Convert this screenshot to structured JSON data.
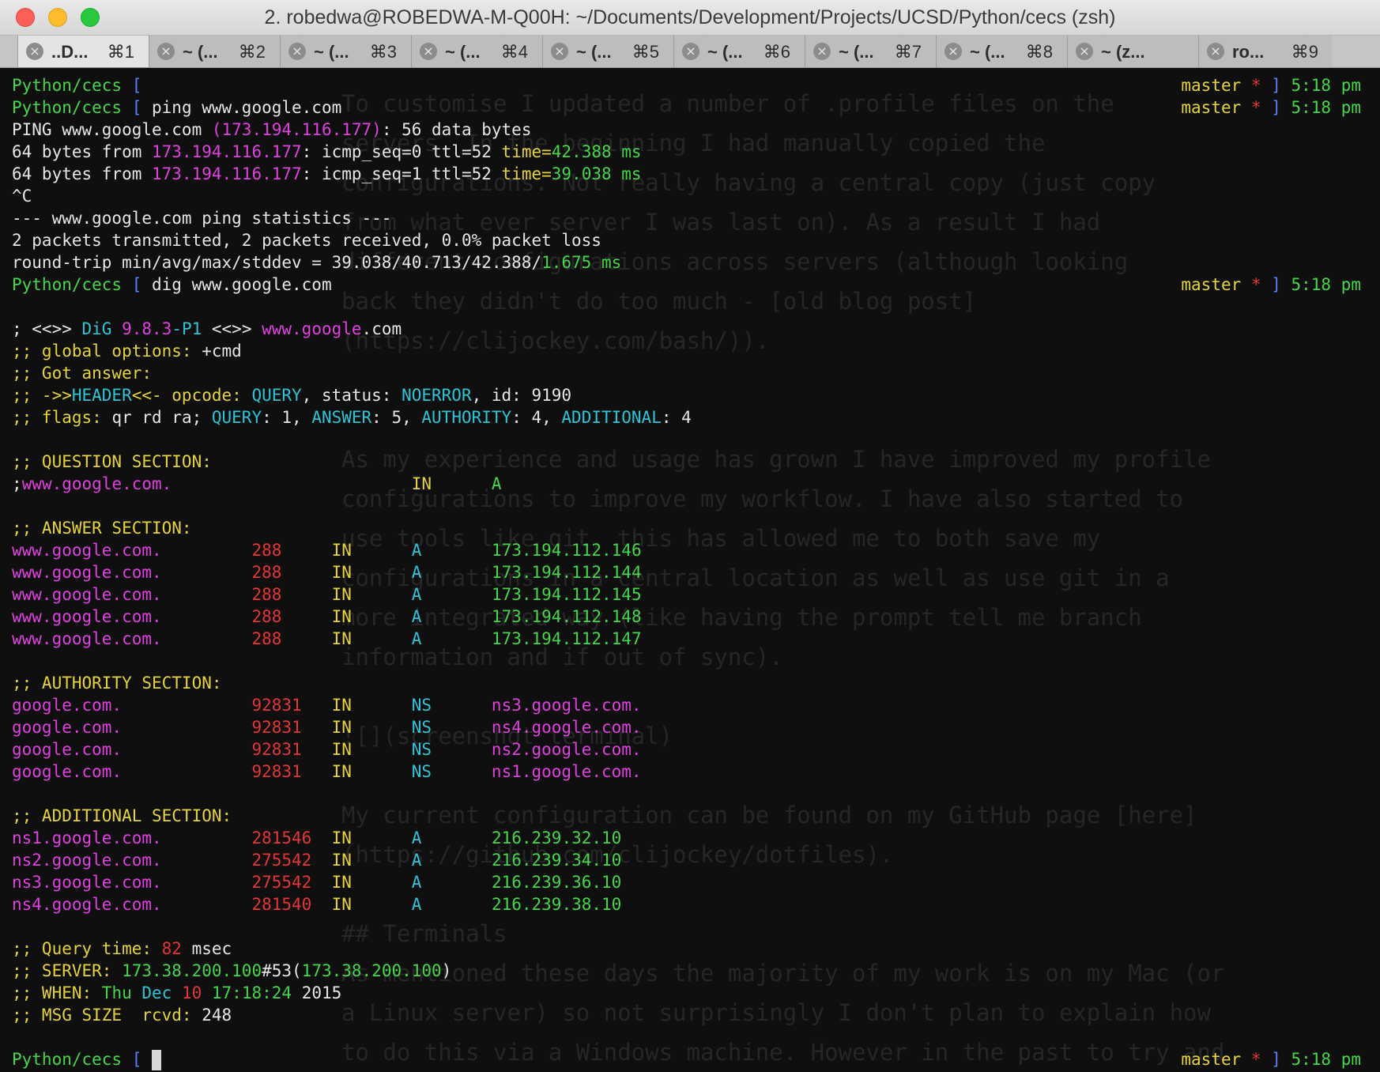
{
  "window": {
    "title": "2. robedwa@ROBEDWA-M-Q00H: ~/Documents/Development/Projects/UCSD/Python/cecs (zsh)"
  },
  "tabs": [
    {
      "label": "..D...",
      "shortcut": "⌘1",
      "active": true
    },
    {
      "label": "~ (...",
      "shortcut": "⌘2"
    },
    {
      "label": "~ (...",
      "shortcut": "⌘3"
    },
    {
      "label": "~ (...",
      "shortcut": "⌘4"
    },
    {
      "label": "~ (...",
      "shortcut": "⌘5"
    },
    {
      "label": "~ (...",
      "shortcut": "⌘6"
    },
    {
      "label": "~ (...",
      "shortcut": "⌘7"
    },
    {
      "label": "~ (...",
      "shortcut": "⌘8"
    },
    {
      "label": "~ (z...",
      "shortcut": ""
    },
    {
      "label": "ro...",
      "shortcut": "⌘9"
    }
  ],
  "terminal": {
    "lines": [
      {
        "segs": [
          [
            "Python/cecs",
            "green"
          ],
          [
            " [",
            "blue"
          ]
        ],
        "right": [
          [
            "master",
            "yellow"
          ],
          [
            " * ",
            "red"
          ],
          [
            "] ",
            "blue"
          ],
          [
            "5:18 pm",
            "green"
          ]
        ]
      },
      {
        "segs": [
          [
            "Python/cecs",
            "green"
          ],
          [
            " [ ",
            "blue"
          ],
          [
            "ping www.google.com",
            "white"
          ]
        ],
        "right": [
          [
            "master",
            "yellow"
          ],
          [
            " * ",
            "red"
          ],
          [
            "] ",
            "blue"
          ],
          [
            "5:18 pm",
            "green"
          ]
        ]
      },
      {
        "segs": [
          [
            "PING www.google.com ",
            "white"
          ],
          [
            "(173.194.116.177)",
            "magenta"
          ],
          [
            ": 56 data bytes",
            "white"
          ]
        ]
      },
      {
        "segs": [
          [
            "64 bytes from ",
            "white"
          ],
          [
            "173.194.116.177",
            "magenta"
          ],
          [
            ": icmp_seq=0 ttl=52 ",
            "white"
          ],
          [
            "time=",
            "yellow"
          ],
          [
            "42.388 ms",
            "green"
          ]
        ]
      },
      {
        "segs": [
          [
            "64 bytes from ",
            "white"
          ],
          [
            "173.194.116.177",
            "magenta"
          ],
          [
            ": icmp_seq=1 ttl=52 ",
            "white"
          ],
          [
            "time=",
            "yellow"
          ],
          [
            "39.038 ms",
            "green"
          ]
        ]
      },
      {
        "segs": [
          [
            "^C",
            "white"
          ]
        ]
      },
      {
        "segs": [
          [
            "--- www.google.com ping statistics ---",
            "white"
          ]
        ]
      },
      {
        "segs": [
          [
            "2 packets transmitted, 2 packets received, 0.0% packet loss",
            "white"
          ]
        ]
      },
      {
        "segs": [
          [
            "round-trip min/avg/max/stddev = 39.038/40.713/42.388/",
            "white"
          ],
          [
            "1.675 ms",
            "green"
          ]
        ]
      },
      {
        "segs": [
          [
            "Python/cecs",
            "green"
          ],
          [
            " [ ",
            "blue"
          ],
          [
            "dig www.google.com",
            "white"
          ]
        ],
        "right": [
          [
            "master",
            "yellow"
          ],
          [
            " * ",
            "red"
          ],
          [
            "] ",
            "blue"
          ],
          [
            "5:18 pm",
            "green"
          ]
        ]
      },
      {
        "segs": [
          [
            "",
            "white"
          ]
        ]
      },
      {
        "segs": [
          [
            "; <<>> ",
            "white"
          ],
          [
            "DiG",
            "cyan"
          ],
          [
            " 9.8.3",
            "magenta"
          ],
          [
            "-P1",
            "cyan"
          ],
          [
            " <<>> ",
            "white"
          ],
          [
            "www.google",
            "magenta"
          ],
          [
            ".com",
            "white"
          ]
        ]
      },
      {
        "segs": [
          [
            ";; global options: ",
            "yellow"
          ],
          [
            "+cmd",
            "white"
          ]
        ]
      },
      {
        "segs": [
          [
            ";; Got answer:",
            "yellow"
          ]
        ]
      },
      {
        "segs": [
          [
            ";; ->>",
            "yellow"
          ],
          [
            "HEADER",
            "cyan"
          ],
          [
            "<<- opcode: ",
            "yellow"
          ],
          [
            "QUERY",
            "cyan"
          ],
          [
            ", status: ",
            "white"
          ],
          [
            "NOERROR",
            "cyan"
          ],
          [
            ", id: 9190",
            "white"
          ]
        ]
      },
      {
        "segs": [
          [
            ";; flags: ",
            "yellow"
          ],
          [
            "qr rd ra; ",
            "white"
          ],
          [
            "QUERY",
            "cyan"
          ],
          [
            ": 1, ",
            "white"
          ],
          [
            "ANSWER",
            "cyan"
          ],
          [
            ": 5, ",
            "white"
          ],
          [
            "AUTHORITY",
            "cyan"
          ],
          [
            ": 4, ",
            "white"
          ],
          [
            "ADDITIONAL",
            "cyan"
          ],
          [
            ": 4",
            "white"
          ]
        ]
      },
      {
        "segs": [
          [
            "",
            "white"
          ]
        ]
      },
      {
        "segs": [
          [
            ";; QUESTION SECTION:",
            "yellow"
          ]
        ]
      },
      {
        "segs": [
          [
            ";",
            "white"
          ],
          [
            "www.google.com.",
            "magenta"
          ],
          [
            "                        ",
            "white"
          ],
          [
            "IN",
            "yellow"
          ],
          [
            "      ",
            "white"
          ],
          [
            "A",
            "green"
          ]
        ]
      },
      {
        "segs": [
          [
            "",
            "white"
          ]
        ]
      },
      {
        "segs": [
          [
            ";; ANSWER SECTION:",
            "yellow"
          ]
        ]
      },
      {
        "segs": [
          [
            "www.google.com.",
            "magenta"
          ],
          [
            "         ",
            "white"
          ],
          [
            "288",
            "red"
          ],
          [
            "     ",
            "white"
          ],
          [
            "IN",
            "yellow"
          ],
          [
            "      ",
            "white"
          ],
          [
            "A",
            "cyan"
          ],
          [
            "       ",
            "white"
          ],
          [
            "173.194.112.146",
            "green"
          ]
        ]
      },
      {
        "segs": [
          [
            "www.google.com.",
            "magenta"
          ],
          [
            "         ",
            "white"
          ],
          [
            "288",
            "red"
          ],
          [
            "     ",
            "white"
          ],
          [
            "IN",
            "yellow"
          ],
          [
            "      ",
            "white"
          ],
          [
            "A",
            "cyan"
          ],
          [
            "       ",
            "white"
          ],
          [
            "173.194.112.144",
            "green"
          ]
        ]
      },
      {
        "segs": [
          [
            "www.google.com.",
            "magenta"
          ],
          [
            "         ",
            "white"
          ],
          [
            "288",
            "red"
          ],
          [
            "     ",
            "white"
          ],
          [
            "IN",
            "yellow"
          ],
          [
            "      ",
            "white"
          ],
          [
            "A",
            "cyan"
          ],
          [
            "       ",
            "white"
          ],
          [
            "173.194.112.145",
            "green"
          ]
        ]
      },
      {
        "segs": [
          [
            "www.google.com.",
            "magenta"
          ],
          [
            "         ",
            "white"
          ],
          [
            "288",
            "red"
          ],
          [
            "     ",
            "white"
          ],
          [
            "IN",
            "yellow"
          ],
          [
            "      ",
            "white"
          ],
          [
            "A",
            "cyan"
          ],
          [
            "       ",
            "white"
          ],
          [
            "173.194.112.148",
            "green"
          ]
        ]
      },
      {
        "segs": [
          [
            "www.google.com.",
            "magenta"
          ],
          [
            "         ",
            "white"
          ],
          [
            "288",
            "red"
          ],
          [
            "     ",
            "white"
          ],
          [
            "IN",
            "yellow"
          ],
          [
            "      ",
            "white"
          ],
          [
            "A",
            "cyan"
          ],
          [
            "       ",
            "white"
          ],
          [
            "173.194.112.147",
            "green"
          ]
        ]
      },
      {
        "segs": [
          [
            "",
            "white"
          ]
        ]
      },
      {
        "segs": [
          [
            ";; AUTHORITY SECTION:",
            "yellow"
          ]
        ]
      },
      {
        "segs": [
          [
            "google.com.",
            "magenta"
          ],
          [
            "             ",
            "white"
          ],
          [
            "92831",
            "red"
          ],
          [
            "   ",
            "white"
          ],
          [
            "IN",
            "yellow"
          ],
          [
            "      ",
            "white"
          ],
          [
            "NS",
            "cyan"
          ],
          [
            "      ",
            "white"
          ],
          [
            "ns3.google.com.",
            "magenta"
          ]
        ]
      },
      {
        "segs": [
          [
            "google.com.",
            "magenta"
          ],
          [
            "             ",
            "white"
          ],
          [
            "92831",
            "red"
          ],
          [
            "   ",
            "white"
          ],
          [
            "IN",
            "yellow"
          ],
          [
            "      ",
            "white"
          ],
          [
            "NS",
            "cyan"
          ],
          [
            "      ",
            "white"
          ],
          [
            "ns4.google.com.",
            "magenta"
          ]
        ]
      },
      {
        "segs": [
          [
            "google.com.",
            "magenta"
          ],
          [
            "             ",
            "white"
          ],
          [
            "92831",
            "red"
          ],
          [
            "   ",
            "white"
          ],
          [
            "IN",
            "yellow"
          ],
          [
            "      ",
            "white"
          ],
          [
            "NS",
            "cyan"
          ],
          [
            "      ",
            "white"
          ],
          [
            "ns2.google.com.",
            "magenta"
          ]
        ]
      },
      {
        "segs": [
          [
            "google.com.",
            "magenta"
          ],
          [
            "             ",
            "white"
          ],
          [
            "92831",
            "red"
          ],
          [
            "   ",
            "white"
          ],
          [
            "IN",
            "yellow"
          ],
          [
            "      ",
            "white"
          ],
          [
            "NS",
            "cyan"
          ],
          [
            "      ",
            "white"
          ],
          [
            "ns1.google.com.",
            "magenta"
          ]
        ]
      },
      {
        "segs": [
          [
            "",
            "white"
          ]
        ]
      },
      {
        "segs": [
          [
            ";; ADDITIONAL SECTION:",
            "yellow"
          ]
        ]
      },
      {
        "segs": [
          [
            "ns1.google.com.",
            "magenta"
          ],
          [
            "         ",
            "white"
          ],
          [
            "281546",
            "red"
          ],
          [
            "  ",
            "white"
          ],
          [
            "IN",
            "yellow"
          ],
          [
            "      ",
            "white"
          ],
          [
            "A",
            "cyan"
          ],
          [
            "       ",
            "white"
          ],
          [
            "216.239.32.10",
            "green"
          ]
        ]
      },
      {
        "segs": [
          [
            "ns2.google.com.",
            "magenta"
          ],
          [
            "         ",
            "white"
          ],
          [
            "275542",
            "red"
          ],
          [
            "  ",
            "white"
          ],
          [
            "IN",
            "yellow"
          ],
          [
            "      ",
            "white"
          ],
          [
            "A",
            "cyan"
          ],
          [
            "       ",
            "white"
          ],
          [
            "216.239.34.10",
            "green"
          ]
        ]
      },
      {
        "segs": [
          [
            "ns3.google.com.",
            "magenta"
          ],
          [
            "         ",
            "white"
          ],
          [
            "275542",
            "red"
          ],
          [
            "  ",
            "white"
          ],
          [
            "IN",
            "yellow"
          ],
          [
            "      ",
            "white"
          ],
          [
            "A",
            "cyan"
          ],
          [
            "       ",
            "white"
          ],
          [
            "216.239.36.10",
            "green"
          ]
        ]
      },
      {
        "segs": [
          [
            "ns4.google.com.",
            "magenta"
          ],
          [
            "         ",
            "white"
          ],
          [
            "281540",
            "red"
          ],
          [
            "  ",
            "white"
          ],
          [
            "IN",
            "yellow"
          ],
          [
            "      ",
            "white"
          ],
          [
            "A",
            "cyan"
          ],
          [
            "       ",
            "white"
          ],
          [
            "216.239.38.10",
            "green"
          ]
        ]
      },
      {
        "segs": [
          [
            "",
            "white"
          ]
        ]
      },
      {
        "segs": [
          [
            ";; Query time: ",
            "yellow"
          ],
          [
            "82",
            "red"
          ],
          [
            " msec",
            "white"
          ]
        ]
      },
      {
        "segs": [
          [
            ";; SERVER: ",
            "yellow"
          ],
          [
            "173.38.200.100",
            "green"
          ],
          [
            "#53(",
            "white"
          ],
          [
            "173.38.200.100",
            "green"
          ],
          [
            ")",
            "white"
          ]
        ]
      },
      {
        "segs": [
          [
            ";; WHEN: ",
            "yellow"
          ],
          [
            "Thu",
            "green"
          ],
          [
            " Dec ",
            "cyan"
          ],
          [
            "10",
            "red"
          ],
          [
            " 17:18:24",
            "green"
          ],
          [
            " 2015",
            "white"
          ]
        ]
      },
      {
        "segs": [
          [
            ";; MSG SIZE  rcvd: ",
            "yellow"
          ],
          [
            "248",
            "white"
          ]
        ]
      },
      {
        "segs": [
          [
            "",
            "white"
          ]
        ]
      },
      {
        "segs": [
          [
            "Python/cecs",
            "green"
          ],
          [
            " [ ",
            "blue"
          ]
        ],
        "cursor": true,
        "right": [
          [
            "master",
            "yellow"
          ],
          [
            " * ",
            "red"
          ],
          [
            "] ",
            "blue"
          ],
          [
            "5:18 pm",
            "green"
          ]
        ]
      }
    ]
  },
  "background_text": {
    "lines": [
      "To customise I updated a number of .profile files on the",
      "servers. In the beginning I had manually copied the",
      "configurations. Not really having a central copy (just copy",
      "from what ever server I was last on). As a result I had",
      "different configurations across servers (although looking",
      "back they didn't do too much - [old blog post]",
      "(https://clijockey.com/bash/)).",
      "",
      "",
      "As my experience and usage has grown I have improved my profile",
      "configurations to improve my workflow. I have also started to",
      "use tools like git, this has allowed me to both save my",
      "configurations in a central location as well as use git in a",
      "more integrated way (like having the prompt tell me branch",
      "information and if out of sync).",
      "",
      "![](screenshot_terminal)",
      "",
      "My current configuration can be found on my GitHub page [here]",
      "(https://github.com/clijockey/dotfiles).",
      "",
      "## Terminals",
      "As mentioned these days the majority of my work is on my Mac (or",
      "a Linux server) so not surprisingly I don't plan to explain how",
      "to do this via a Windows machine. However in the past to try and"
    ]
  },
  "colors": {
    "green": "#45d64a",
    "yellow": "#e6d33c",
    "magenta": "#e040e0",
    "cyan": "#2ec4d6",
    "red": "#e53535",
    "blue": "#5a7cff",
    "white": "#e6e6e6",
    "background": "#0f0f0f"
  }
}
